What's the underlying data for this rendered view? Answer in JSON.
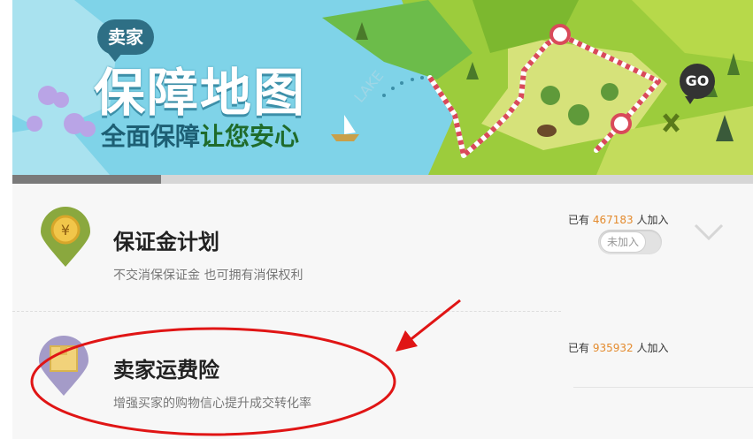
{
  "banner": {
    "badge": "卖家",
    "title": "保障地图",
    "subtitle_prefix": "全面保障",
    "subtitle_highlight": "让您安心",
    "map_text": "LAKE",
    "go_label": "GO"
  },
  "plans": [
    {
      "icon": "yuan-coin-icon",
      "icon_glyph": "¥",
      "title": "保证金计划",
      "description": "不交消保保证金 也可拥有消保权利",
      "count_prefix": "已有",
      "count": "467183",
      "count_suffix": "人加入",
      "toggle_label": "未加入",
      "expand_icon": "chevron-down-icon"
    },
    {
      "icon": "package-icon",
      "title": "卖家运费险",
      "description": "增强买家的购物信心提升成交转化率",
      "count_prefix": "已有",
      "count": "935932",
      "count_suffix": "人加入"
    }
  ],
  "colors": {
    "lake": "#7fd3e8",
    "grass": "#9ccc3c",
    "accent_count": "#e48b2e",
    "annotation": "#e01515"
  }
}
